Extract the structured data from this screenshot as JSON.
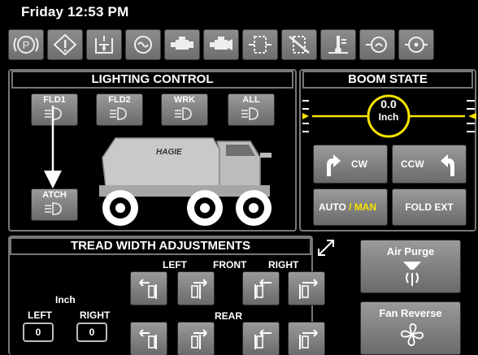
{
  "status": {
    "clock": "Friday 12:53 PM"
  },
  "warning_icons": [
    "parking-brake-icon",
    "warning-icon",
    "tank-level-icon",
    "turbo-icon",
    "engine-icon",
    "engine-alt-icon",
    "filter-icon",
    "filter-blocked-icon",
    "transmission-temp-icon",
    "hydraulic-icon",
    "fan-icon"
  ],
  "lighting": {
    "title": "LIGHTING CONTROL",
    "fld1": "FLD1",
    "fld2": "FLD2",
    "wrk": "WRK",
    "all": "ALL",
    "atch": "ATCH",
    "machine_brand": "HAGIE"
  },
  "boom": {
    "title": "BOOM STATE",
    "value": "0.0",
    "unit": "Inch",
    "cw": "CW",
    "ccw": "CCW",
    "auto": "AUTO",
    "slash": "/",
    "man": "MAN",
    "fold_ext": "FOLD EXT"
  },
  "tread": {
    "title": "TREAD WIDTH ADJUSTMENTS",
    "left": "LEFT",
    "front": "FRONT",
    "right": "RIGHT",
    "rear": "REAR",
    "unit": "Inch",
    "left_label": "LEFT",
    "right_label": "RIGHT",
    "left_value": "0",
    "right_value": "0"
  },
  "side_buttons": {
    "air_purge": "Air Purge",
    "fan_reverse": "Fan Reverse"
  },
  "colors": {
    "accent_yellow": "#f7e400",
    "panel_border": "#777777",
    "button_gray": "#8a8a8a"
  }
}
